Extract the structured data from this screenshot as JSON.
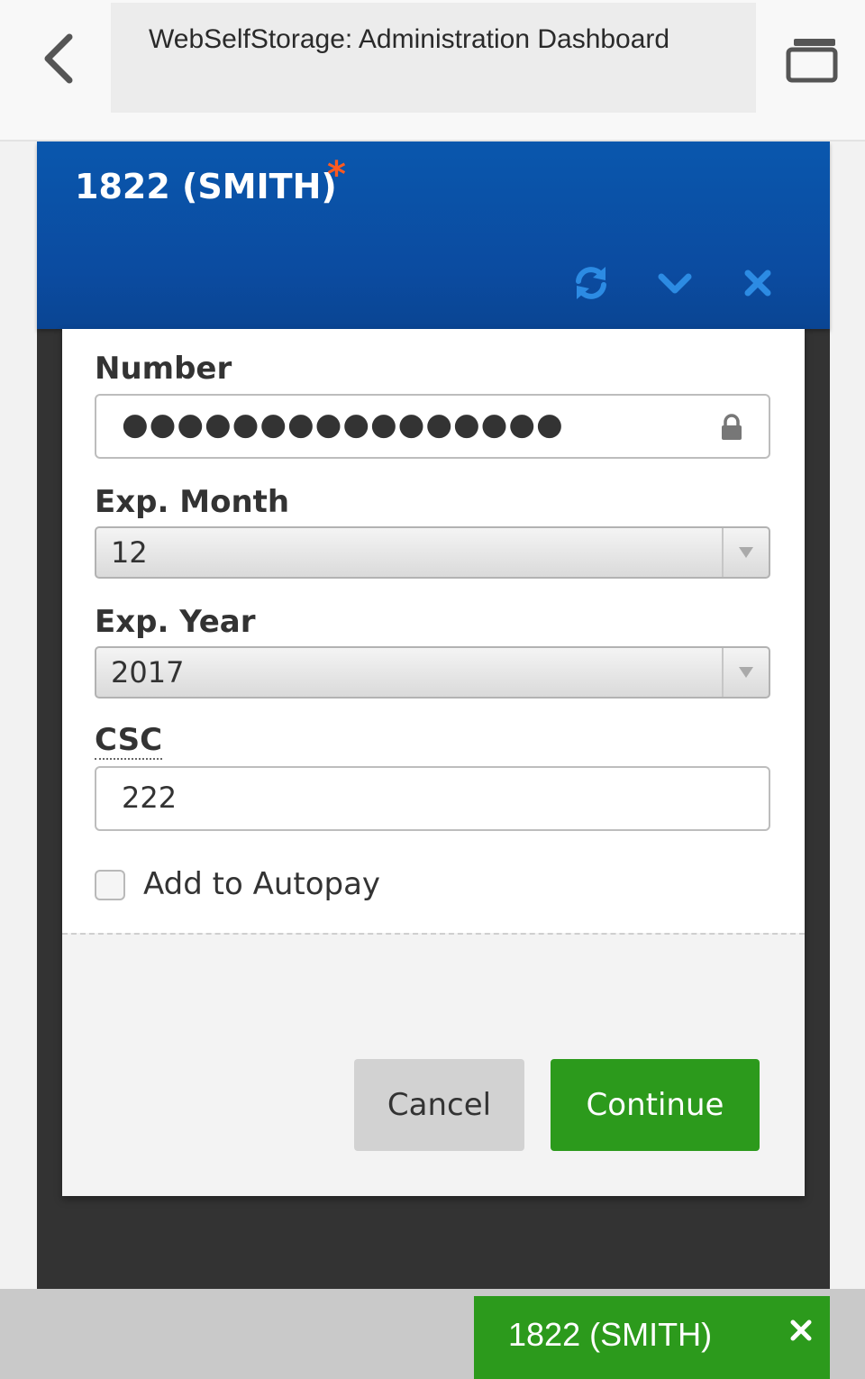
{
  "app_bar": {
    "title": "WebSelfStorage: Administration Dashboard",
    "back_icon": "chevron-left-icon",
    "tabs_icon": "tabs-icon"
  },
  "window": {
    "title": "1822 (SMITH)",
    "modified_marker": "*",
    "controls": [
      "refresh-icon",
      "chevron-down-icon",
      "close-icon"
    ],
    "header_color": "#0b4ba0"
  },
  "form": {
    "number_label": "Number",
    "number_value": "●●●●●●●●●●●●●●●●",
    "exp_month_label": "Exp. Month",
    "exp_month_value": "12",
    "exp_year_label": "Exp. Year",
    "exp_year_value": "2017",
    "csc_label": "CSC",
    "csc_value": "222",
    "autopay_label": "Add to Autopay",
    "autopay_checked": false
  },
  "buttons": {
    "cancel": "Cancel",
    "continue": "Continue",
    "continue_color": "#2c9a1c"
  },
  "taskbar": {
    "item_label": "1822 (SMITH)",
    "close_icon": "close-icon"
  }
}
